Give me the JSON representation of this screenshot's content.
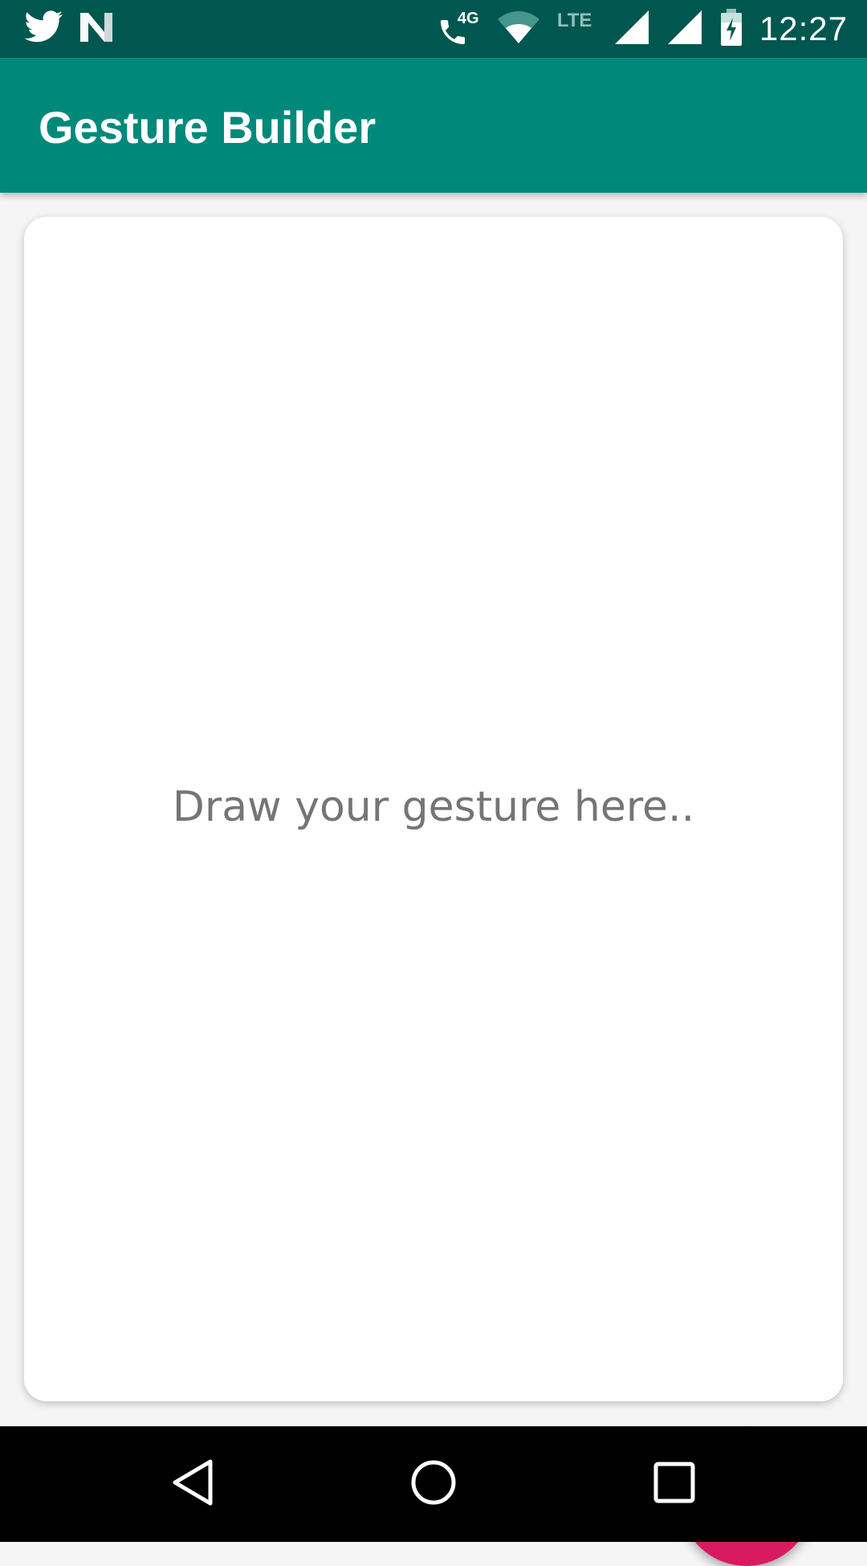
{
  "colors": {
    "status_bar": "#00574f",
    "primary": "#00897b",
    "accent": "#d81b60",
    "hint_text": "#757575"
  },
  "status_bar": {
    "left_icons": [
      "twitter-icon",
      "n-app-icon"
    ],
    "right_icons": [
      "wifi-calling-icon",
      "wifi-icon",
      "lte-signal-icon",
      "cell-signal-icon",
      "cell-signal-icon",
      "battery-charging-icon"
    ],
    "network_4g": "4G",
    "network_lte": "LTE",
    "time": "12:27"
  },
  "app_bar": {
    "title": "Gesture Builder"
  },
  "gesture_pad": {
    "hint": "Draw your gesture here.."
  },
  "fab": {
    "icon": "list-icon"
  },
  "nav_bar": {
    "buttons": [
      "back-icon",
      "home-icon",
      "recents-icon"
    ]
  }
}
